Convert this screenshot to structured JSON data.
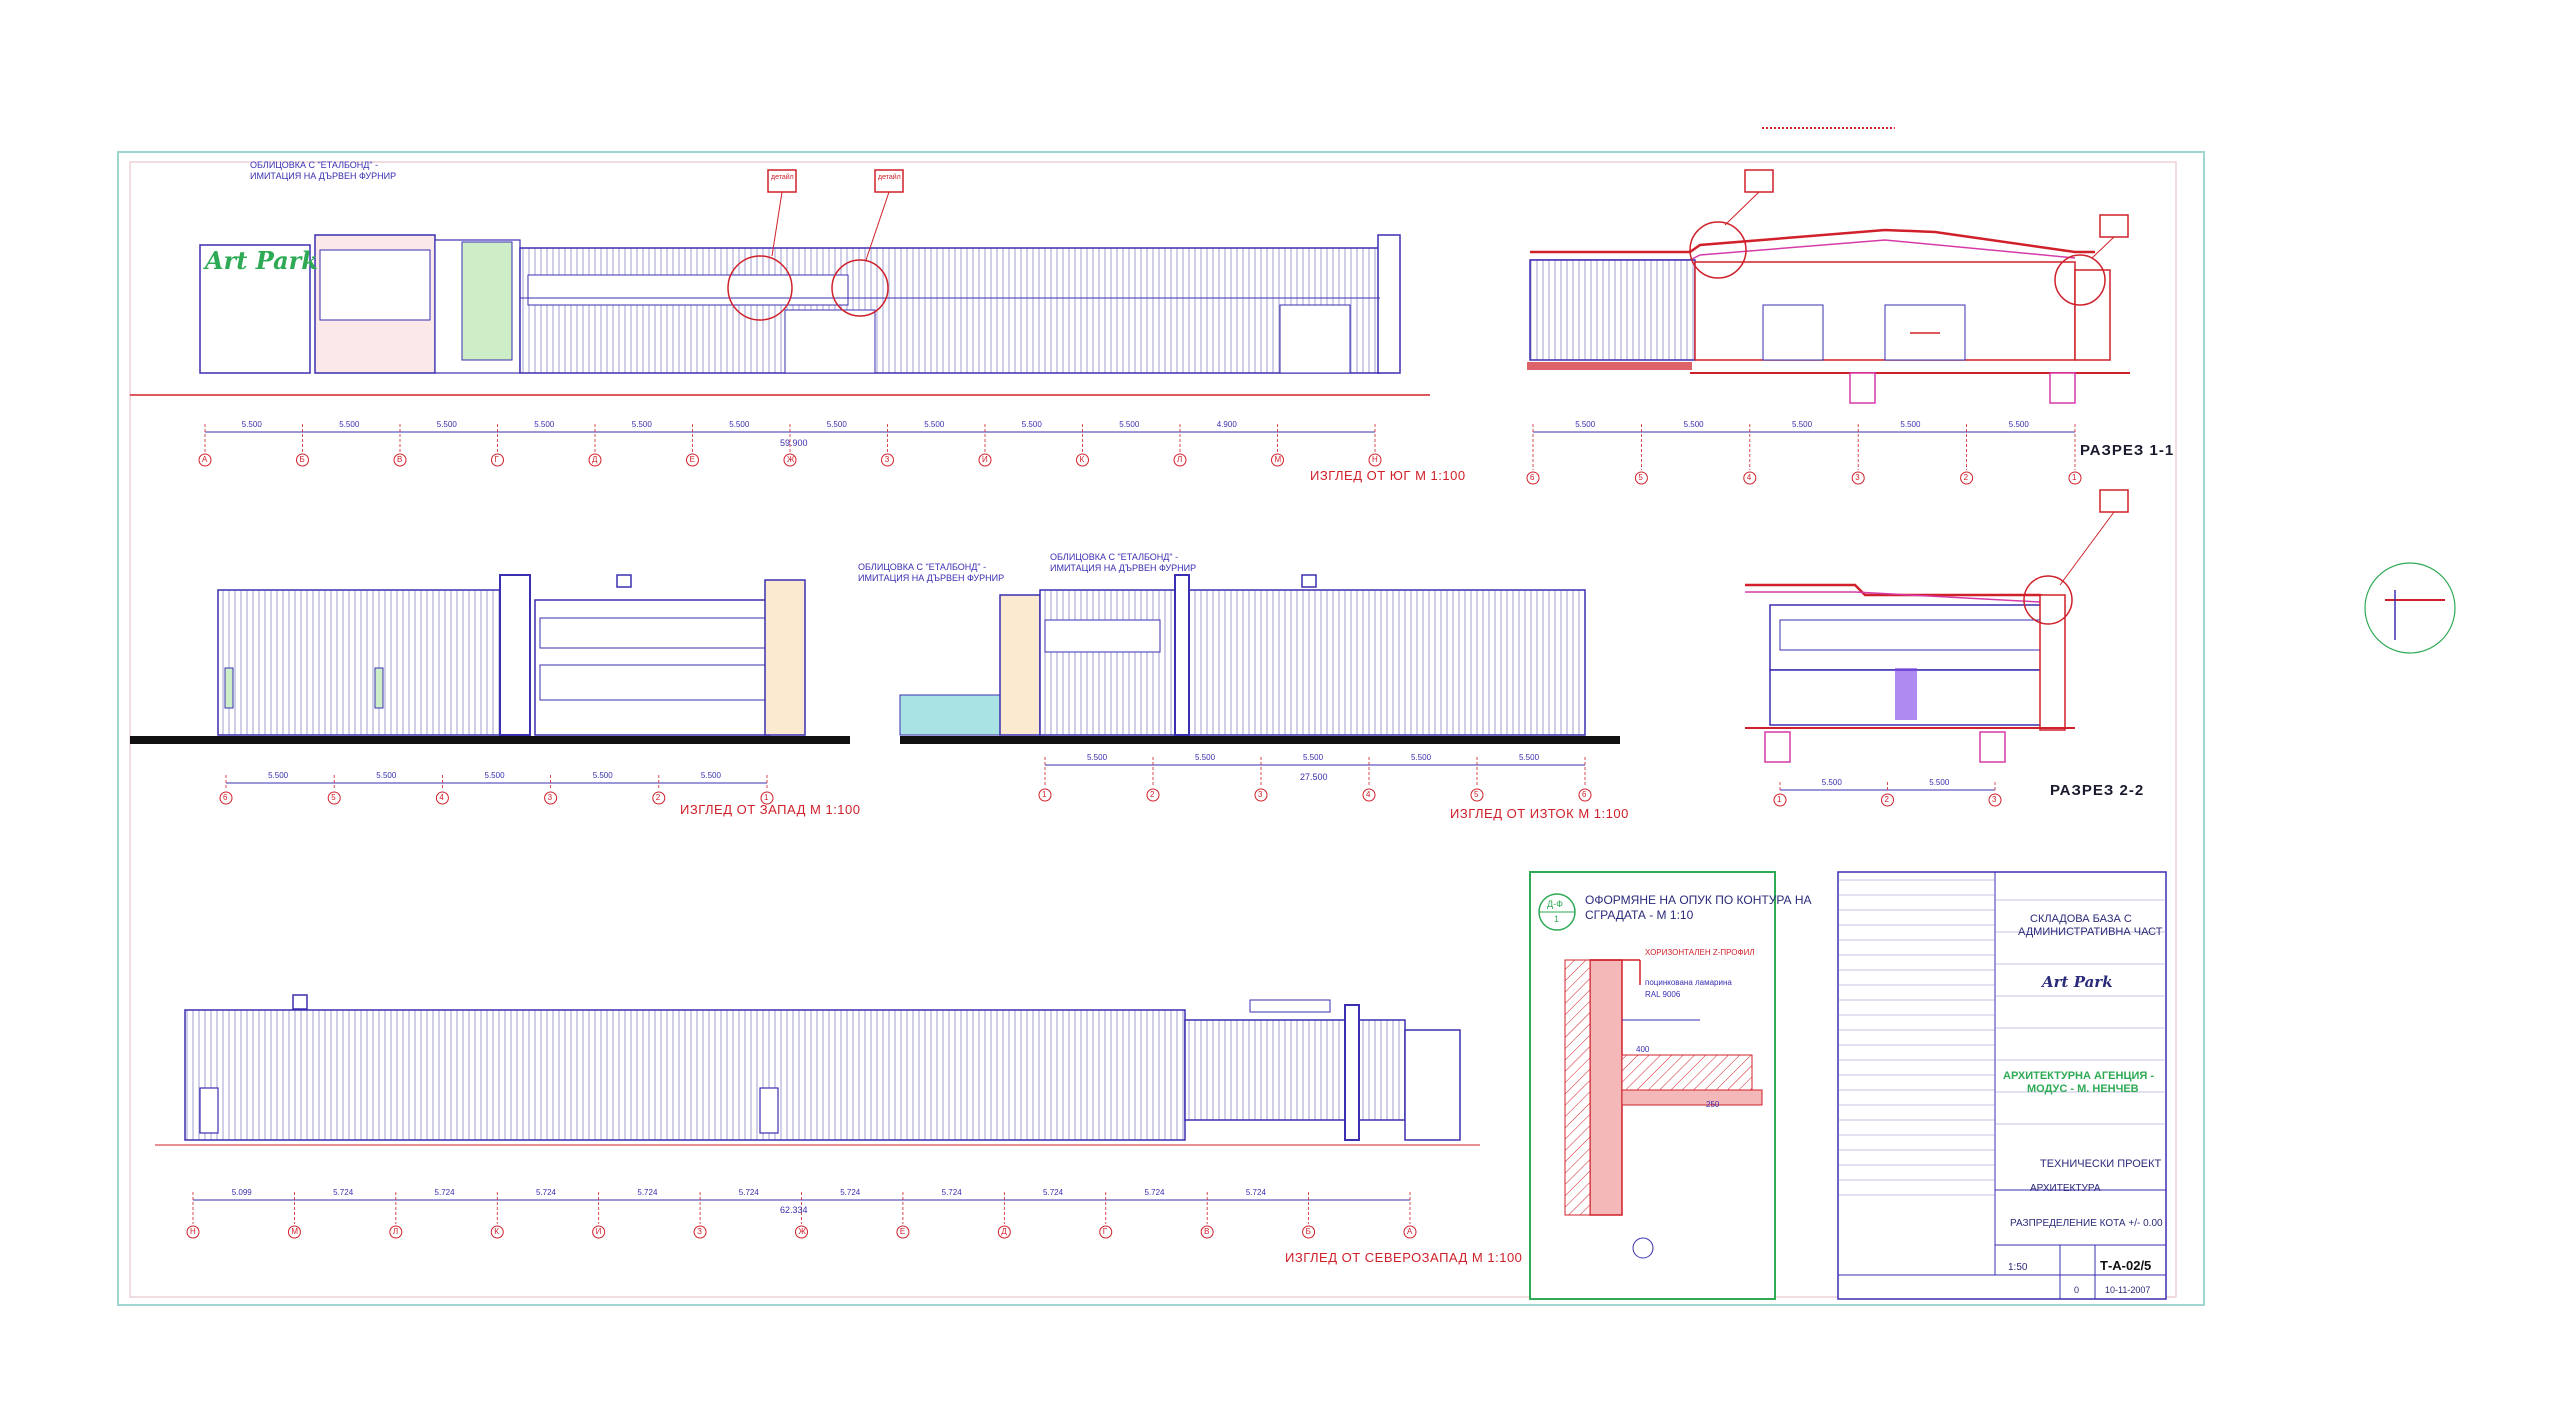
{
  "logo_text": "Art Park",
  "views": {
    "south": {
      "title": "ИЗГЛЕД ОТ ЮГ  М 1:100",
      "cladding_1": "ОБЛИЦОВКА С \"ЕТАЛБОНД\" -",
      "cladding_2": "ИМИТАЦИЯ НА ДЪРВЕН ФУРНИР",
      "detail_a": "детайл",
      "detail_b": "детайл",
      "total": "59.900"
    },
    "section11": {
      "title": "РАЗРЕЗ  1-1"
    },
    "west": {
      "title": "ИЗГЛЕД ОТ ЗАПАД  М 1:100",
      "cladding_1": "ОБЛИЦОВКА С \"ЕТАЛБОНД\" -",
      "cladding_2": "ИМИТАЦИЯ НА ДЪРВЕН ФУРНИР"
    },
    "east": {
      "title": "ИЗГЛЕД ОТ ИЗТОК  М 1:100",
      "cladding_1": "ОБЛИЦОВКА С \"ЕТАЛБОНД\" -",
      "cladding_2": "ИМИТАЦИЯ НА ДЪРВЕН ФУРНИР",
      "total": "27.500"
    },
    "section22": {
      "title": "РАЗРЕЗ  2-2"
    },
    "northwest": {
      "title": "ИЗГЛЕД ОТ СЕВЕРОЗАПАД  М 1:100",
      "total": "62.334"
    }
  },
  "south_dims": [
    "5.500",
    "5.500",
    "5.500",
    "5.500",
    "5.500",
    "5.500",
    "5.500",
    "5.500",
    "5.500",
    "5.500",
    "4.900"
  ],
  "south_axes": [
    "А",
    "Б",
    "В",
    "Г",
    "Д",
    "Е",
    "Ж",
    "З",
    "И",
    "К",
    "Л",
    "М",
    "Н"
  ],
  "sec11_dims": [
    "5.500",
    "5.500",
    "5.500",
    "5.500",
    "5.500"
  ],
  "sec11_axes": [
    "6",
    "5",
    "4",
    "3",
    "2",
    "1"
  ],
  "west_dims": [
    "5.500",
    "5.500",
    "5.500",
    "5.500",
    "5.500"
  ],
  "west_axes": [
    "6",
    "5",
    "4",
    "3",
    "2",
    "1"
  ],
  "east_dims": [
    "5.500",
    "5.500",
    "5.500",
    "5.500",
    "5.500"
  ],
  "east_axes": [
    "1",
    "2",
    "3",
    "4",
    "5",
    "6"
  ],
  "sec22_dims": [
    "5.500",
    "5.500"
  ],
  "sec22_axes": [
    "1",
    "2",
    "3"
  ],
  "nw_dims": [
    "5.099",
    "5.724",
    "5.724",
    "5.724",
    "5.724",
    "5.724",
    "5.724",
    "5.724",
    "5.724",
    "5.724",
    "5.724"
  ],
  "nw_axes": [
    "Н",
    "М",
    "Л",
    "К",
    "И",
    "З",
    "Ж",
    "Е",
    "Д",
    "Г",
    "В",
    "Б",
    "А"
  ],
  "detail_box": {
    "tag": "Д-Ф",
    "num": "1",
    "title_1": "ОФОРМЯНЕ НА ОПУК ПО КОНТУРА НА",
    "title_2": "СГРАДАТА - М 1:10",
    "note_1": "ХОРИЗОНТАЛЕН Z-ПРОФИЛ",
    "note_2": "поцинкована ламарина",
    "note_3": "RAL 9006",
    "dim_1": "400",
    "dim_2": "250"
  },
  "title_block": {
    "project_1": "СКЛАДОВА БАЗА С",
    "project_2": "АДМИНИСТРАТИВНА ЧАСТ",
    "agency_1": "АРХИТЕКТУРНА АГЕНЦИЯ -",
    "agency_2": "МОДУС - М. НЕНЧЕВ",
    "phase": "ТЕХНИЧЕСКИ ПРОЕКТ",
    "part": "АРХИТЕКТУРА",
    "drawing": "РАЗПРЕДЕЛЕНИЕ КОТА +/- 0.00",
    "scale": "1:50",
    "sheet": "Т-А-02/5",
    "rev": "0",
    "date": "10-11-2007"
  },
  "colors": {
    "line": "#3a2fb0",
    "red": "#d0202a",
    "green": "#2eaa55",
    "magenta": "#d63aa8",
    "frame": "#9fd7d0"
  }
}
